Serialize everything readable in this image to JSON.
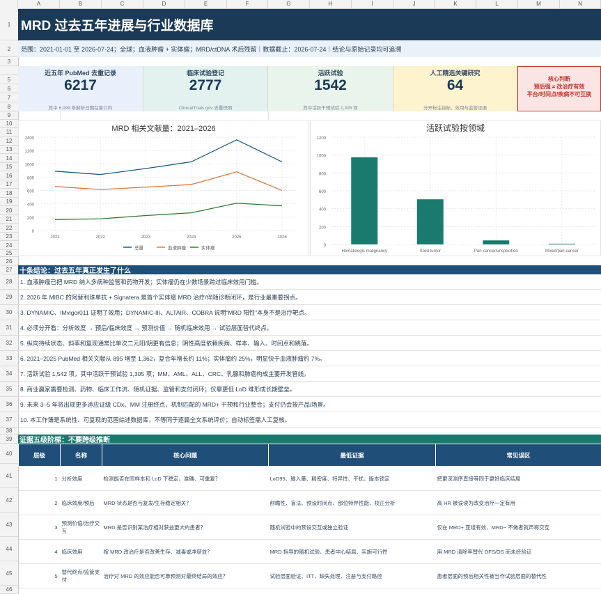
{
  "columns": [
    "A",
    "B",
    "C",
    "D",
    "E",
    "F",
    "G",
    "H",
    "I",
    "J",
    "K",
    "L",
    "M",
    "N"
  ],
  "rows": [
    "1",
    "2",
    "3",
    "5",
    "6",
    "7",
    "8",
    "9",
    "10",
    "11",
    "12",
    "13",
    "14",
    "15",
    "16",
    "17",
    "18",
    "19",
    "20",
    "21",
    "22",
    "23",
    "24",
    "25",
    "26",
    "27",
    "28",
    "29",
    "30",
    "31",
    "32",
    "33",
    "34",
    "35",
    "36",
    "37",
    "38",
    "39",
    "40",
    "41",
    "42",
    "43",
    "44",
    "45",
    "46"
  ],
  "title": "MRD 过去五年进展与行业数据库",
  "scope": "范围：2021-01-01 至 2026-07-24；全球；血液肿瘤 + 实体瘤；MRD/ctDNA 术后残留｜数据截止：2026-07-24｜结论与原始记录均可追溯",
  "kpis": [
    {
      "label": "近五年 PubMed 去重记录",
      "value": "6217",
      "note": "其中 6,099 条解析日期在窗口内",
      "bg": "#e9f0fb"
    },
    {
      "label": "临床试验登记",
      "value": "2777",
      "note": "ClinicalTrials.gov 去重快照",
      "bg": "#e3f1ef"
    },
    {
      "label": "活跃试验",
      "value": "1542",
      "note": "其中活跃干预试验 1,305 项",
      "bg": "#e9f4ec"
    },
    {
      "label": "人工精选关键研究",
      "value": "64",
      "note": "分开标注指标、效用与监管证据",
      "bg": "#fdf3cf"
    }
  ],
  "judge": {
    "line1": "核心判断",
    "line2": "预后强 ≠ 改治疗有效",
    "line3": "平台/时间点/疾病不可互换"
  },
  "chart_data": [
    {
      "type": "line",
      "title": "MRD 相关文献量：2021–2026",
      "categories": [
        "2021",
        "2022",
        "2023",
        "2024",
        "2025",
        "2026"
      ],
      "ylim": [
        0,
        1400
      ],
      "yticks": [
        "0",
        "200",
        "400",
        "600",
        "800",
        "1000",
        "1200",
        "1400"
      ],
      "legend": "bottom",
      "series": [
        {
          "name": "总量",
          "color": "#1b5e86",
          "values": [
            890,
            840,
            930,
            1030,
            1360,
            1030
          ]
        },
        {
          "name": "血液肿瘤",
          "color": "#e0783a",
          "values": [
            660,
            615,
            650,
            690,
            880,
            600
          ]
        },
        {
          "name": "实体瘤",
          "color": "#2e7d32",
          "values": [
            165,
            175,
            225,
            265,
            410,
            370
          ]
        }
      ]
    },
    {
      "type": "bar",
      "title": "活跃试验按领域",
      "categories": [
        "Hematologic malignancy",
        "Solid tumor",
        "Pan-cancer/unspecified",
        "Mixed/pan-cancer"
      ],
      "values": [
        975,
        505,
        45,
        8
      ],
      "ylim": [
        0,
        1200
      ],
      "yticks": [
        "0",
        "200",
        "400",
        "600",
        "800",
        "1000",
        "1200"
      ],
      "color": "#1a7a6e"
    }
  ],
  "sec1": "十条结论：过去五年真正发生了什么",
  "conclusions": [
    "1. 血液肿瘤已把 MRD 纳入多病种监管和药物开发；实体瘤仍在少数场景跨过临床效用门槛。",
    "2. 2026 年 MIBC 的阿替利珠单抗 + Signatera 是首个实体瘤 MRD 治疗/伴随诊断闭环，是行业最重要拐点。",
    "3. DYNAMIC、IMvigor011 证明了效用；DYNAMIC-III、ALTAIR、COBRA 说明“MRD 阳性”本身不是治疗靶点。",
    "4. 必须分开看：分析效度 → 预后/临床效度 → 预测价值 → 随机临床效用 → 试验层面替代终点。",
    "5. 纵向持续状态、斜率和复现通常比单次二元阳/阴更有信息；阴性高度依赖疾病、样本、输入、时间点和跳落。",
    "6. 2021–2025 PubMed 相关文献从 895 增至 1,362，复合年增长约 11%；实体瘤约 25%，明显快于血液肿瘤约 7%。",
    "7. 活跃试验 1,542 项，其中活跃干预试验 1,305 项；MM、AML、ALL、CRC、乳腺和肺癌构成主要开发管线。",
    "8. 商业赢家需要检测、药物、临床工作流、随机证据、监管和支付闭环；仅靠更低 LoD 难形成长期壁垒。",
    "9. 未来 3–5 年将出现更多适应证级 CDx、MM 注册终点、机制匹配的 MRD+ 干预和行业整合；支付仍会按产品/场景。",
    "10. 本工作簿是系统性、可复现的范围综述数据库，不等同于逐篇全文系统评价；自动标签需人工复核。"
  ],
  "sec2": "证据五级阶梯：不要跨级推断",
  "table": {
    "headers": [
      "层级",
      "名称",
      "核心问题",
      "最低证据",
      "常见误区"
    ],
    "rows": [
      {
        "level": "1",
        "name": "分析效度",
        "q": "检测能否在同样本和 LoD 下稳定、准确、可重复？",
        "ev": "LoD95、输入量、精密度、特异性、干扰、版本锁定",
        "pit": "把更深测序直接等同于更好临床结局"
      },
      {
        "level": "2",
        "name": "临床效度/预后",
        "q": "MRD 状态是否与复发/生存稳定相关？",
        "ev": "前瞻性、盲法、预设时间点、部位特异性能、校正分析",
        "pit": "高 HR 被误读为改变治疗一定有用"
      },
      {
        "level": "3",
        "name": "预测价值/治疗交互",
        "q": "MRD 是否识别某治疗相对获益更大的患者？",
        "ev": "随机试验中的预设交互或独立验证",
        "pit": "仅在 MRD+ 亚组有效、MRD− 不做者就声称交互"
      },
      {
        "level": "4",
        "name": "临床效用",
        "q": "按 MRD 改治疗是否改善生存、减毒或净获益？",
        "ev": "MRD 指导的随机试验、患者中心结局、实施可行性",
        "pit": "用 MRD 清除率替代 DFS/OS 而未经验证"
      },
      {
        "level": "5",
        "name": "替代终点/监管支付",
        "q": "治疗对 MRD 的效应能否可靠预测对最终结局的效应？",
        "ev": "试验层面验证、ITT、缺失处理、注册与支付路径",
        "pit": "患者层面的预后相关性被当作试验层面的替代性"
      }
    ]
  }
}
